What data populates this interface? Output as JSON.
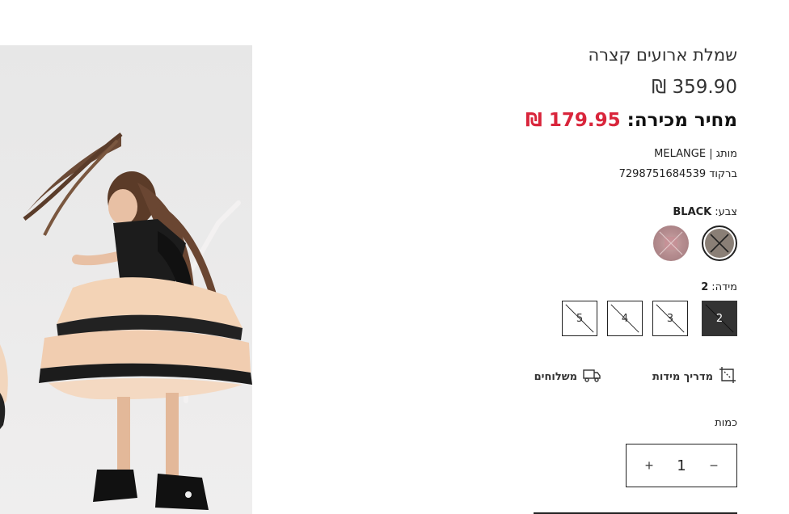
{
  "product": {
    "title": "שמלת ארועים קצרה",
    "old_price": "359.90 ₪",
    "sale_label": "מחיר מכירה:",
    "sale_price": "179.95 ₪",
    "brand_label": "מותג |",
    "brand": "MELANGE",
    "barcode_label": "ברקוד",
    "barcode": "7298751684539"
  },
  "color": {
    "label": "צבע:",
    "selected": "BLACK",
    "swatches": [
      {
        "name": "black-beige",
        "color": "#8a7f76",
        "available": false,
        "selected": true
      },
      {
        "name": "pink",
        "color": "#b68d90",
        "available": false,
        "selected": false
      }
    ]
  },
  "size": {
    "label": "מידה:",
    "selected": "2",
    "options": [
      {
        "label": "2",
        "available": false,
        "selected": true
      },
      {
        "label": "3",
        "available": false,
        "selected": false
      },
      {
        "label": "4",
        "available": false,
        "selected": false
      },
      {
        "label": "5",
        "available": false,
        "selected": false
      }
    ]
  },
  "links": {
    "size_guide": "מדריך מידות",
    "size_guide_icon": "ruler-crop-icon",
    "shipping": "משלוחים",
    "shipping_icon": "truck-icon"
  },
  "quantity": {
    "label": "כמות",
    "value": "1",
    "minus": "−",
    "plus": "+"
  },
  "colors": {
    "sale_red": "#d9253b",
    "text_dark": "#333333",
    "active_size_bg": "#333333"
  }
}
